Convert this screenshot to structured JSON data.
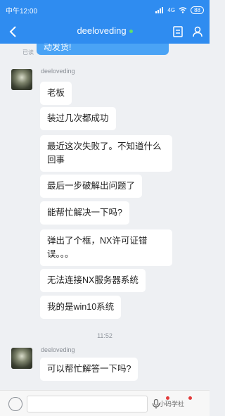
{
  "status_bar": {
    "time": "中午12:00",
    "signal": "4G",
    "battery": "88"
  },
  "header": {
    "title": "deeloveding"
  },
  "chat": {
    "prev_message": "动发货!",
    "read_flag": "已读",
    "groups": [
      {
        "sender": "deeloveding",
        "messages": [
          "老板",
          "装过几次都成功",
          "最近这次失败了。不知道什么回事",
          "最后一步破解出问题了",
          "能帮忙解决一下吗?",
          "弹出了个框，NX许可证错误。。。",
          "无法连接NX服务器系统",
          "我的是win10系统"
        ]
      },
      {
        "sender": "deeloveding",
        "messages": [
          "可以帮忙解答一下吗?"
        ]
      }
    ],
    "timestamp": "11:52"
  },
  "input_bar": {
    "watermark": "小码学社"
  }
}
